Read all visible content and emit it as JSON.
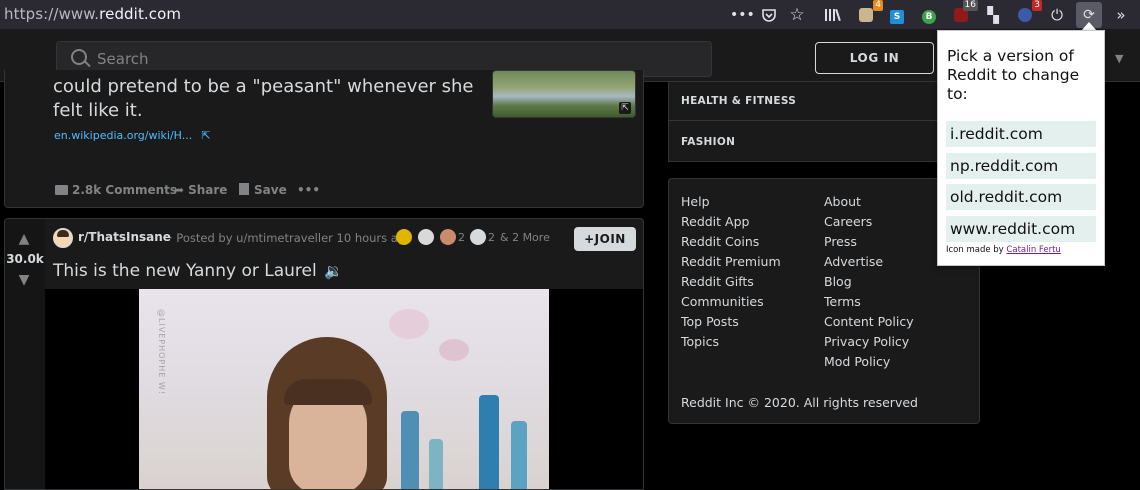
{
  "browser": {
    "url_prefix": "https://www.",
    "url_domain": "reddit.com",
    "badges": {
      "addon_a": "4",
      "addon_ublock": "16",
      "addon_news": "3"
    },
    "addon_letters": {
      "s_ext": "S",
      "b_ext": "B"
    }
  },
  "header": {
    "search_placeholder": "Search",
    "login_label": "LOG IN"
  },
  "post1": {
    "title": "could pretend to be a \"peasant\" whenever she felt like it.",
    "link": "en.wikipedia.org/wiki/H...",
    "comments": "2.8k Comments",
    "share": "Share",
    "save": "Save",
    "more": "•••"
  },
  "post2": {
    "votes": "30.0k",
    "subreddit": "r/ThatsInsane",
    "posted_by": "· Posted by u/mtimetraveller 10 hours ago",
    "award_count_1": "2",
    "award_count_2": "2",
    "more_awards": "& 2 More",
    "join_label": "+JOIN",
    "title": "This is the new Yanny or Laurel",
    "watermark": "@LIVEPHOPHE W!"
  },
  "sidebar": {
    "categories": [
      "HEALTH & FITNESS",
      "FASHION"
    ],
    "links_left": [
      "Help",
      "Reddit App",
      "Reddit Coins",
      "Reddit Premium",
      "Reddit Gifts",
      "Communities",
      "Top Posts",
      "Topics"
    ],
    "links_right": [
      "About",
      "Careers",
      "Press",
      "Advertise",
      "Blog",
      "Terms",
      "Content Policy",
      "Privacy Policy",
      "Mod Policy"
    ],
    "copyright": "Reddit Inc © 2020. All rights reserved"
  },
  "popup": {
    "heading": "Pick a version of Reddit to change to:",
    "options": [
      "i.reddit.com",
      "np.reddit.com",
      "old.reddit.com",
      "www.reddit.com"
    ],
    "credit_prefix": "Icon made by",
    "credit_author": "Catalin Fertu"
  }
}
